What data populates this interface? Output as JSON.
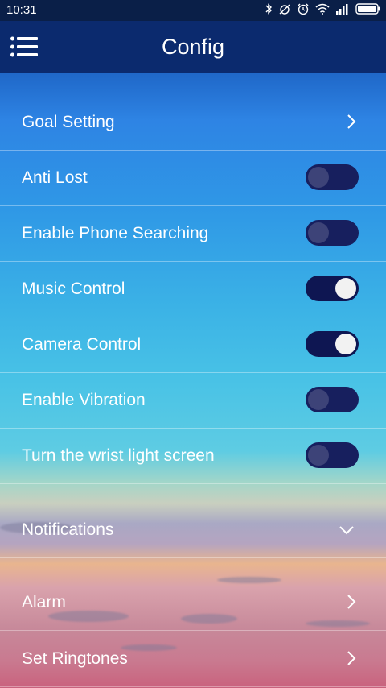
{
  "status_bar": {
    "time": "10:31",
    "icons": [
      "bluetooth-icon",
      "alarm-off-icon",
      "alarm-clock-icon",
      "wifi-icon",
      "signal-icon",
      "battery-icon"
    ]
  },
  "app_bar": {
    "title": "Config",
    "menu_icon": "menu-icon"
  },
  "settings": {
    "goal_setting": {
      "label": "Goal Setting"
    },
    "anti_lost": {
      "label": "Anti Lost",
      "enabled": false
    },
    "phone_searching": {
      "label": "Enable Phone Searching",
      "enabled": false
    },
    "music_control": {
      "label": "Music Control",
      "enabled": true
    },
    "camera_control": {
      "label": "Camera Control",
      "enabled": true
    },
    "vibration": {
      "label": "Enable Vibration",
      "enabled": false
    },
    "wrist_light": {
      "label": "Turn the wrist light screen",
      "enabled": false
    },
    "notifications": {
      "label": "Notifications"
    },
    "alarm": {
      "label": "Alarm"
    },
    "ringtones": {
      "label": "Set Ringtones"
    }
  },
  "colors": {
    "status_bar": "#0a1f48",
    "app_bar": "#0b2a6e",
    "toggle_track": "#171f5e",
    "toggle_knob_on": "#f2f2f2",
    "toggle_knob_off": "#3d4378"
  }
}
